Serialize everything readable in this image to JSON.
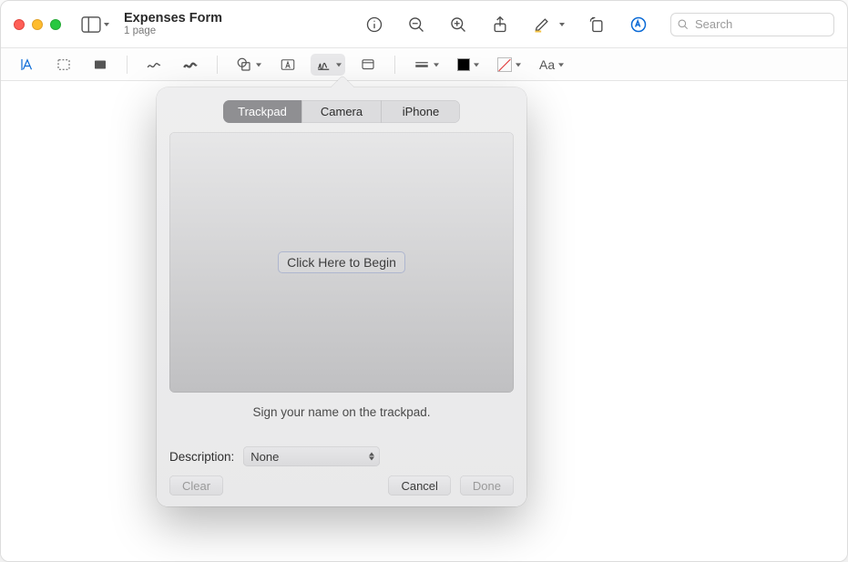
{
  "window": {
    "title": "Expenses Form",
    "subtitle": "1 page"
  },
  "search": {
    "placeholder": "Search"
  },
  "markup": {
    "text_style_label": "Aa"
  },
  "signature_popover": {
    "tabs": [
      "Trackpad",
      "Camera",
      "iPhone"
    ],
    "selected_tab_index": 0,
    "begin_label": "Click Here to Begin",
    "hint": "Sign your name on the trackpad.",
    "description_label": "Description:",
    "description_value": "None",
    "buttons": {
      "clear": "Clear",
      "cancel": "Cancel",
      "done": "Done"
    }
  }
}
